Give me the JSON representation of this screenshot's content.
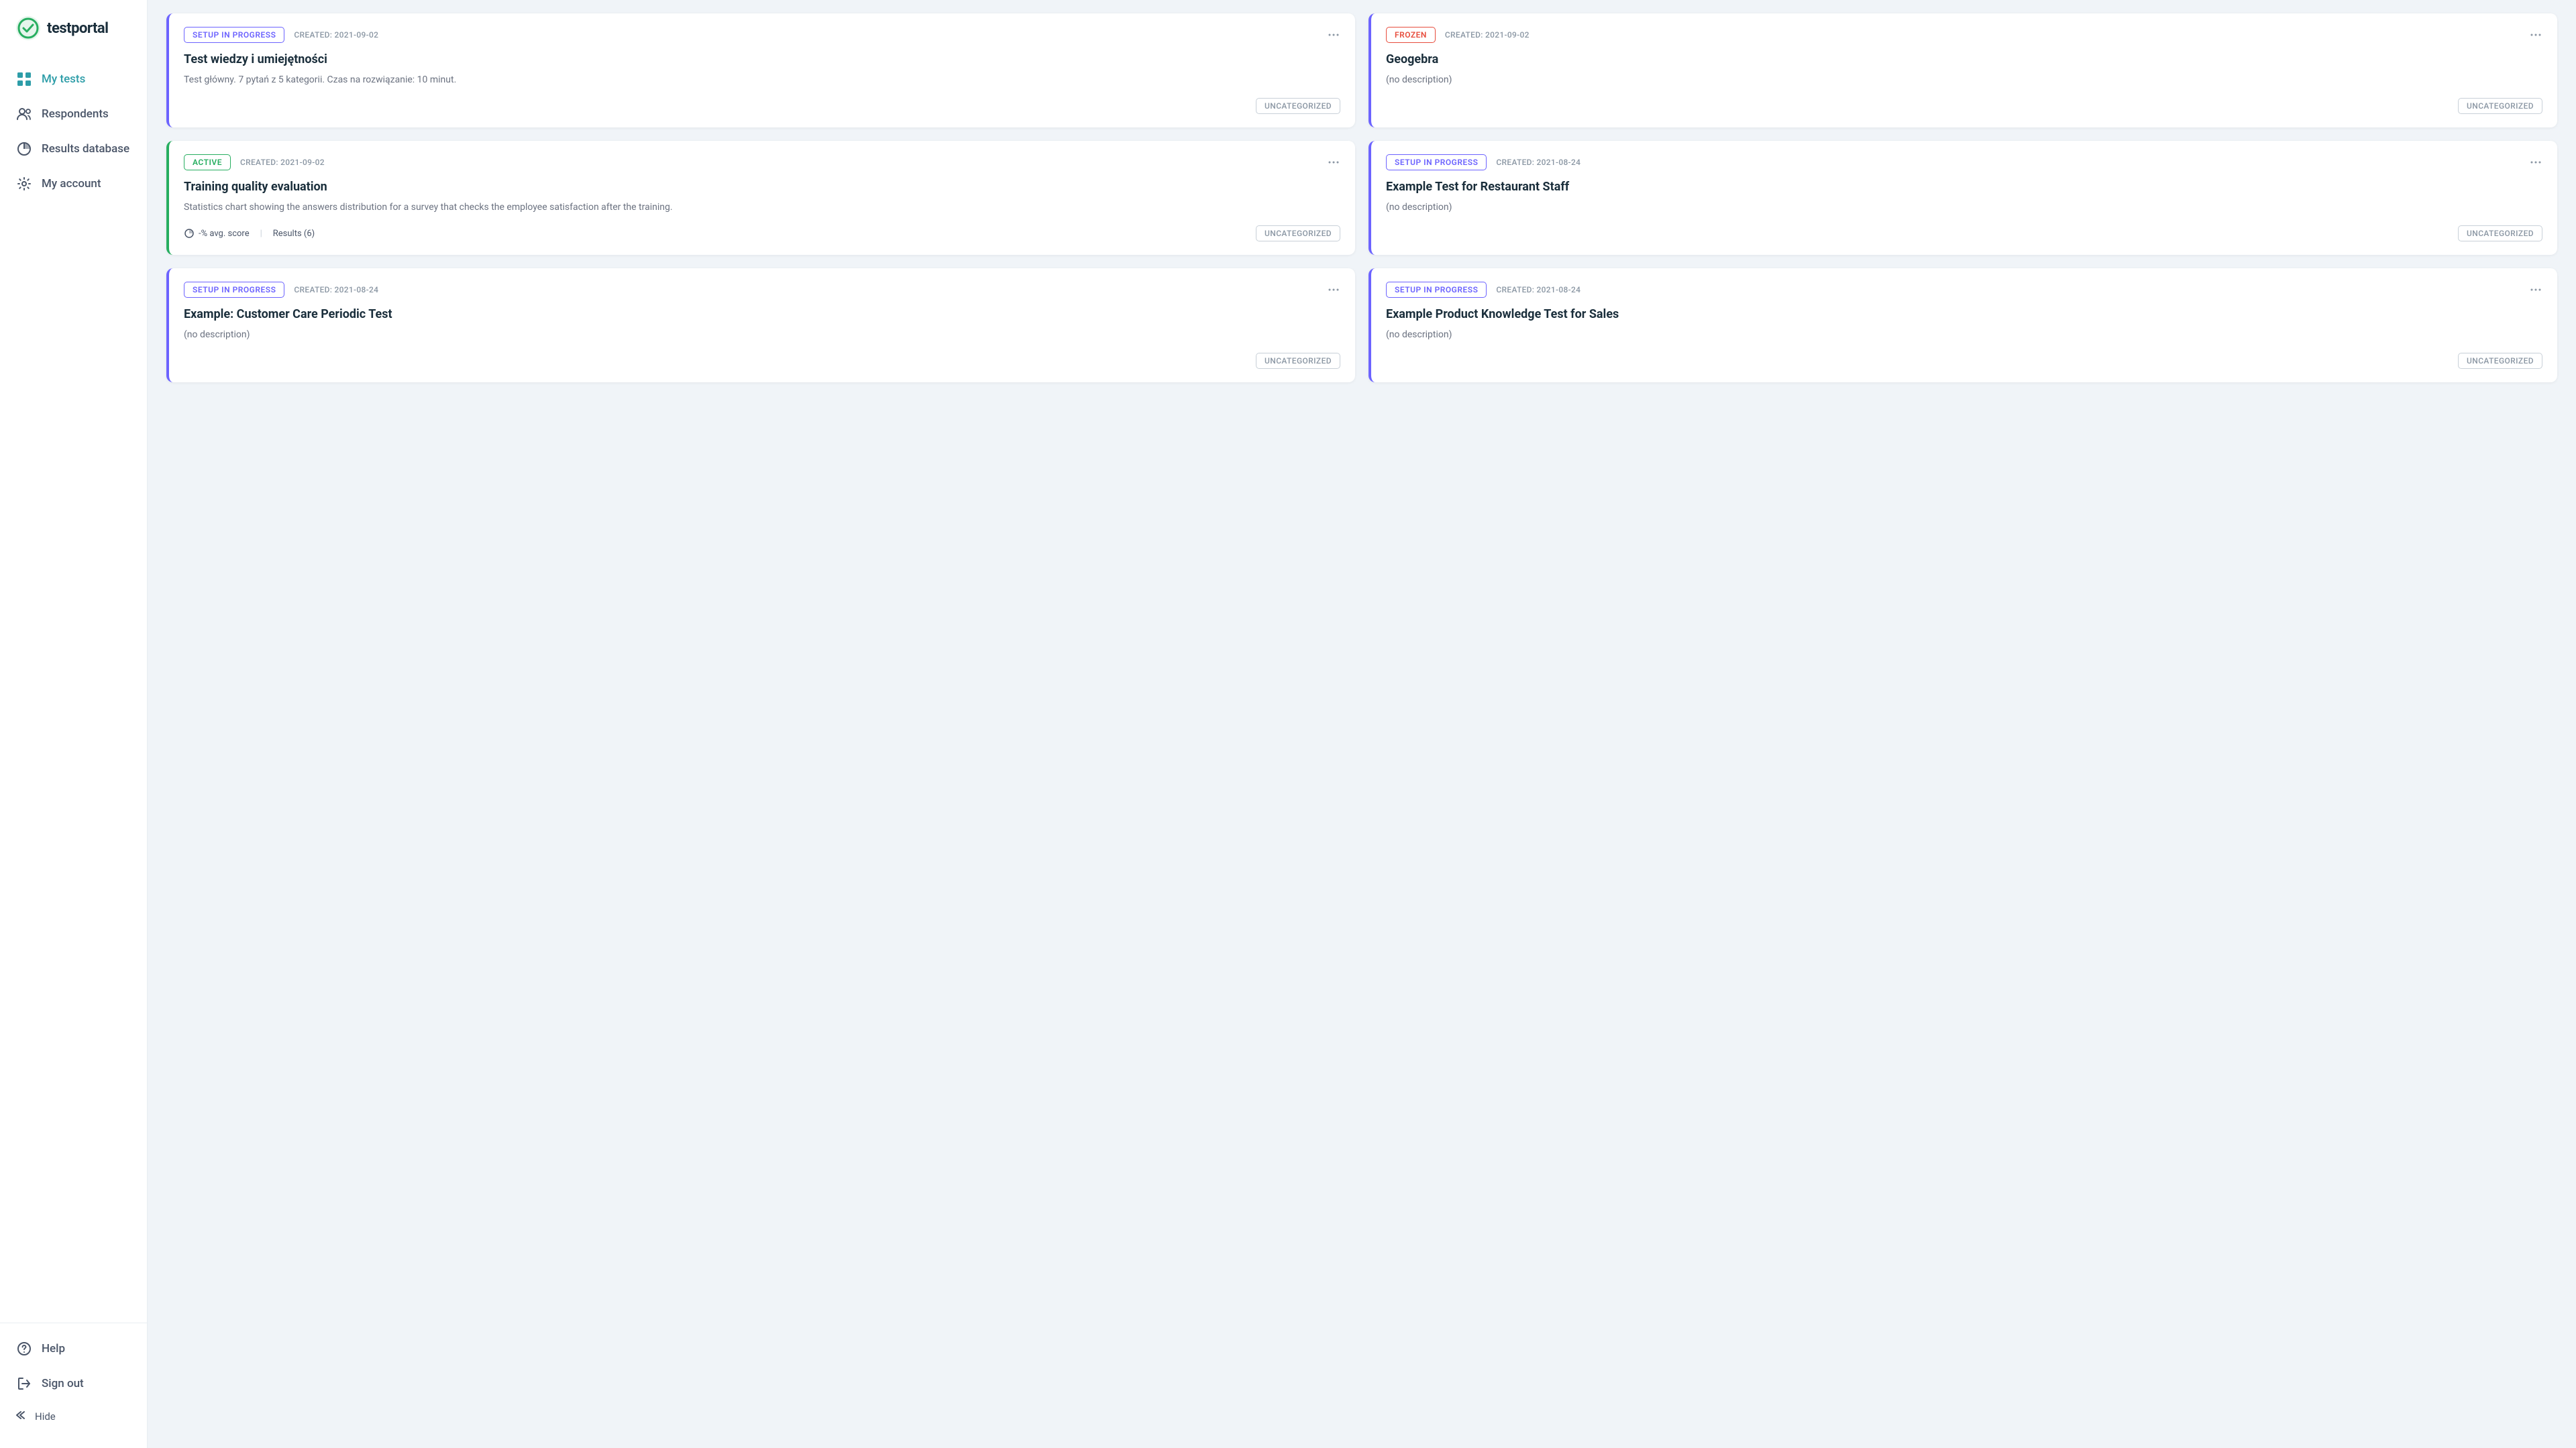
{
  "brand": {
    "logo_text": "testportal"
  },
  "sidebar": {
    "nav_items": [
      {
        "id": "my-tests",
        "label": "My tests",
        "icon": "grid-icon",
        "active": true
      },
      {
        "id": "respondents",
        "label": "Respondents",
        "icon": "people-icon",
        "active": false
      },
      {
        "id": "results-database",
        "label": "Results database",
        "icon": "chart-icon",
        "active": false
      },
      {
        "id": "my-account",
        "label": "My account",
        "icon": "gear-icon",
        "active": false
      }
    ],
    "bottom_items": [
      {
        "id": "help",
        "label": "Help",
        "icon": "help-icon"
      },
      {
        "id": "sign-out",
        "label": "Sign out",
        "icon": "signout-icon"
      }
    ],
    "hide_label": "Hide"
  },
  "cards": [
    {
      "id": "card-1",
      "status": "SETUP IN PROGRESS",
      "status_type": "setup",
      "created": "CREATED: 2021-09-02",
      "title": "Test wiedzy i umiejętności",
      "description": "Test główny. 7 pytań z 5 kategorii. Czas na rozwiązanie: 10 minut.",
      "category": "UNCATEGORIZED",
      "show_stats": false,
      "border_color": "#6c63ff"
    },
    {
      "id": "card-2",
      "status": "FROZEN",
      "status_type": "frozen",
      "created": "CREATED: 2021-09-02",
      "title": "Geogebra",
      "description": "(no description)",
      "category": "UNCATEGORIZED",
      "show_stats": false,
      "border_color": "#6c63ff"
    },
    {
      "id": "card-3",
      "status": "ACTIVE",
      "status_type": "active",
      "created": "CREATED: 2021-09-02",
      "title": "Training quality evaluation",
      "description": "Statistics chart showing the answers distribution for a survey that checks the employee satisfaction after the training.",
      "category": "UNCATEGORIZED",
      "show_stats": true,
      "avg_score": "-% avg. score",
      "results": "Results (6)",
      "border_color": "#27ae60"
    },
    {
      "id": "card-4",
      "status": "SETUP IN PROGRESS",
      "status_type": "setup",
      "created": "CREATED: 2021-08-24",
      "title": "Example Test for Restaurant Staff",
      "description": "(no description)",
      "category": "UNCATEGORIZED",
      "show_stats": false,
      "border_color": "#6c63ff"
    },
    {
      "id": "card-5",
      "status": "SETUP IN PROGRESS",
      "status_type": "setup",
      "created": "CREATED: 2021-08-24",
      "title": "Example: Customer Care Periodic Test",
      "description": "(no description)",
      "category": "UNCATEGORIZED",
      "show_stats": false,
      "border_color": "#6c63ff"
    },
    {
      "id": "card-6",
      "status": "SETUP IN PROGRESS",
      "status_type": "setup",
      "created": "CREATED: 2021-08-24",
      "title": "Example Product Knowledge Test for Sales",
      "description": "(no description)",
      "category": "UNCATEGORIZED",
      "show_stats": false,
      "border_color": "#6c63ff"
    }
  ]
}
